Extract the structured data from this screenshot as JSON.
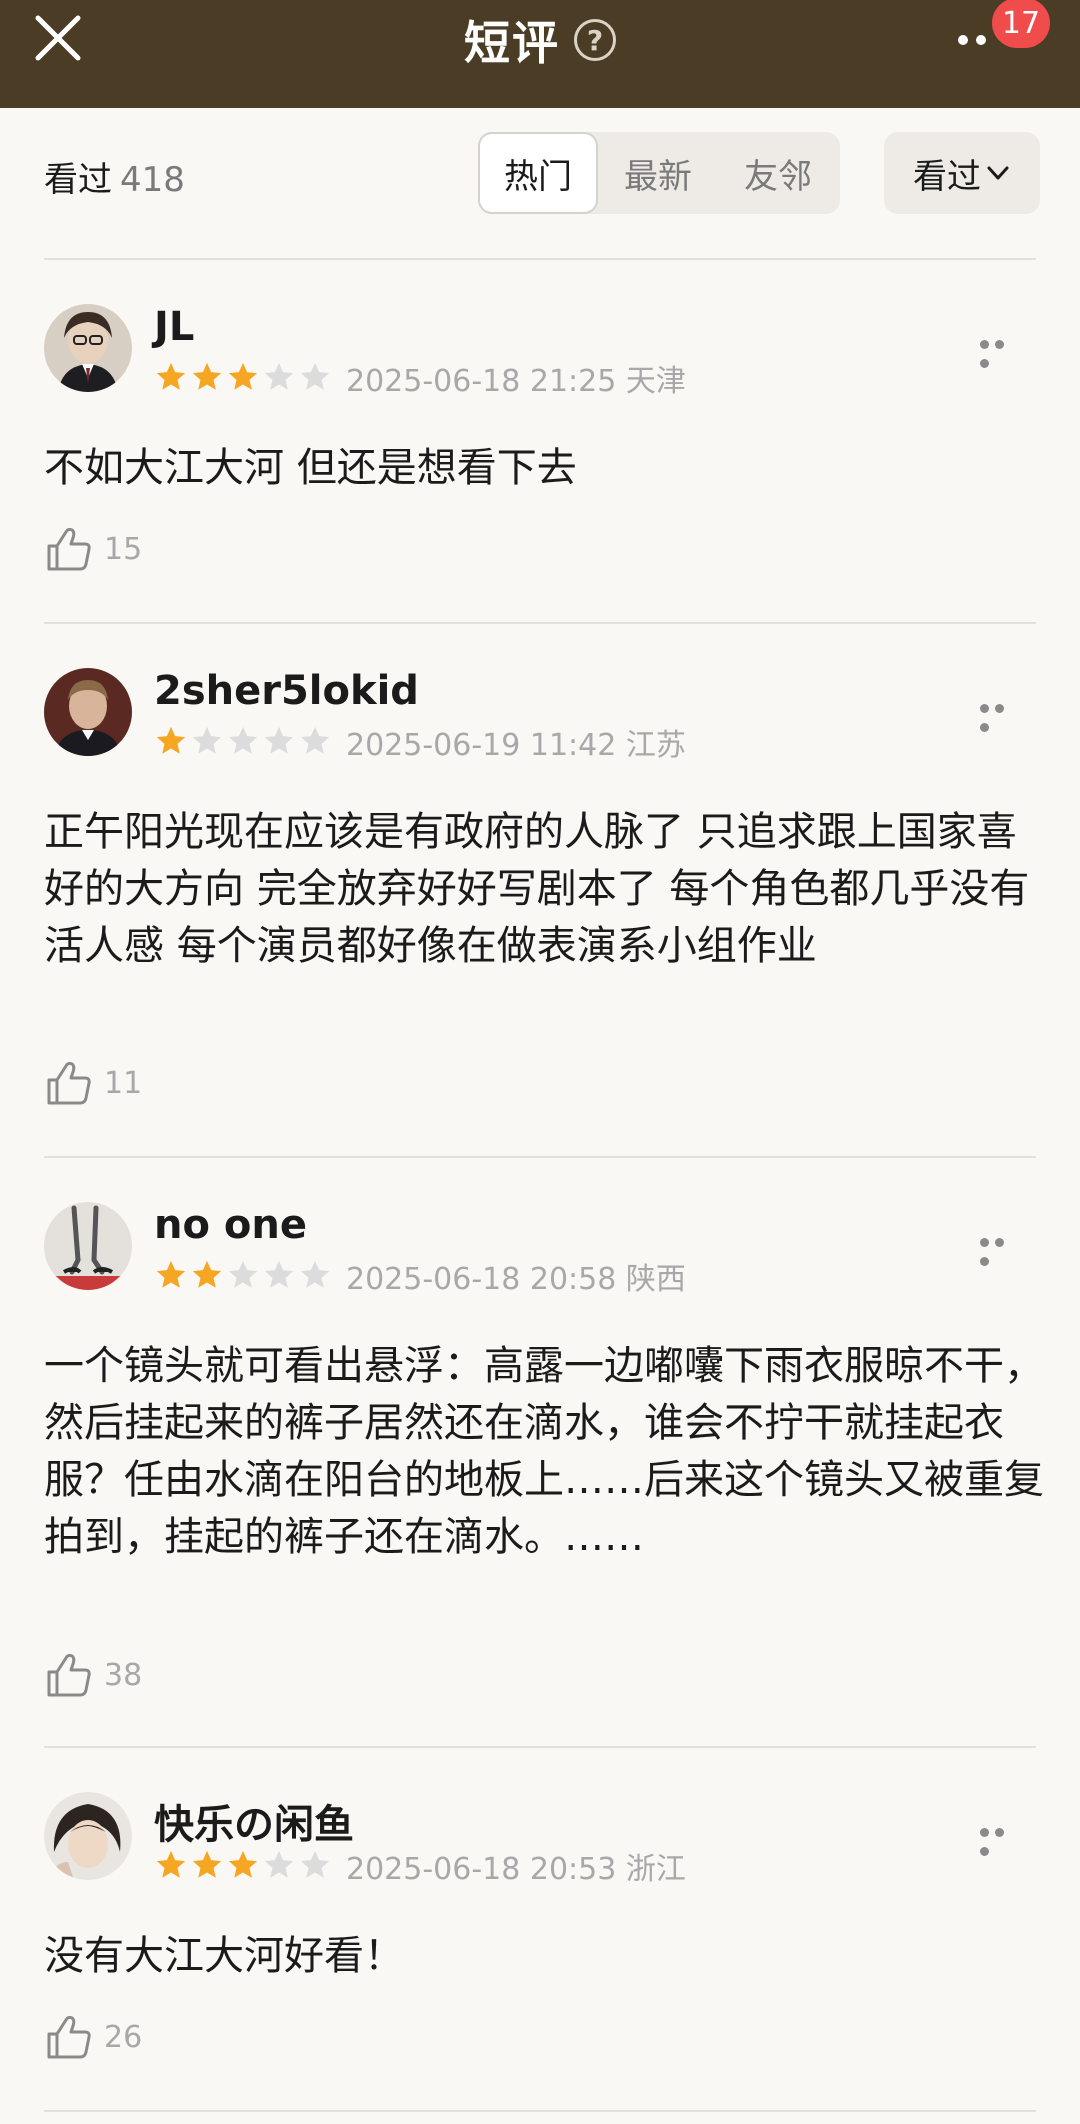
{
  "header": {
    "title": "短评",
    "help_icon": "question-circle-icon",
    "badge_count": "17"
  },
  "filter": {
    "seen_label": "看过",
    "seen_count": "418",
    "tabs": [
      {
        "label": "热门",
        "active": true
      },
      {
        "label": "最新",
        "active": false
      },
      {
        "label": "友邻",
        "active": false
      }
    ],
    "dropdown_label": "看过"
  },
  "colors": {
    "header_bg": "#4b3d25",
    "star_filled": "#f5a623",
    "star_empty": "#dcdcdc",
    "badge": "#f04c4c"
  },
  "comments": [
    {
      "user": "JL",
      "rating": 3,
      "date": "2025-06-18 21:25",
      "location": "天津",
      "text": "不如大江大河 但还是想看下去",
      "likes": "15"
    },
    {
      "user": "2sher5lokid",
      "rating": 1,
      "date": "2025-06-19 11:42",
      "location": "江苏",
      "text": "正午阳光现在应该是有政府的人脉了 只追求跟上国家喜好的大方向 完全放弃好好写剧本了 每个角色都几乎没有活人感 每个演员都好像在做表演系小组作业",
      "likes": "11"
    },
    {
      "user": "no one",
      "rating": 2,
      "date": "2025-06-18 20:58",
      "location": "陕西",
      "text": "一个镜头就可看出悬浮：高露一边嘟囔下雨衣服晾不干，然后挂起来的裤子居然还在滴水，谁会不拧干就挂起衣服？任由水滴在阳台的地板上……后来这个镜头又被重复拍到，挂起的裤子还在滴水。……",
      "likes": "38"
    },
    {
      "user": "快乐の闲鱼",
      "rating": 3,
      "date": "2025-06-18 20:53",
      "location": "浙江",
      "text": "没有大江大河好看！",
      "likes": "26"
    }
  ]
}
